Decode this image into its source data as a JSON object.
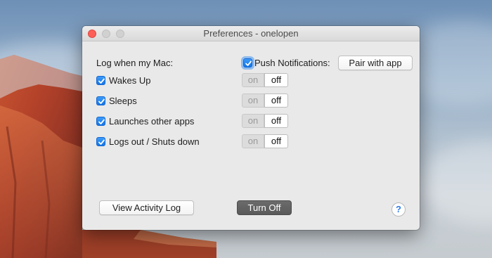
{
  "window": {
    "title": "Preferences - onelopen"
  },
  "log_section": {
    "heading": "Log when my Mac:",
    "items": [
      {
        "label": "Wakes Up",
        "checked": true,
        "on_label": "on",
        "off_label": "off",
        "selected": "off"
      },
      {
        "label": "Sleeps",
        "checked": true,
        "on_label": "on",
        "off_label": "off",
        "selected": "off"
      },
      {
        "label": "Launches other apps",
        "checked": true,
        "on_label": "on",
        "off_label": "off",
        "selected": "off"
      },
      {
        "label": "Logs out / Shuts down",
        "checked": true,
        "on_label": "on",
        "off_label": "off",
        "selected": "off"
      }
    ]
  },
  "push": {
    "label": "Push Notifications:",
    "checked": true,
    "pair_button": "Pair with app"
  },
  "footer": {
    "view_log_button": "View Activity Log",
    "turn_off_button": "Turn Off",
    "help_glyph": "?"
  },
  "colors": {
    "accent": "#1475e6",
    "close": "#fc5f57",
    "turn_off_bg": "#5f5f5f"
  }
}
